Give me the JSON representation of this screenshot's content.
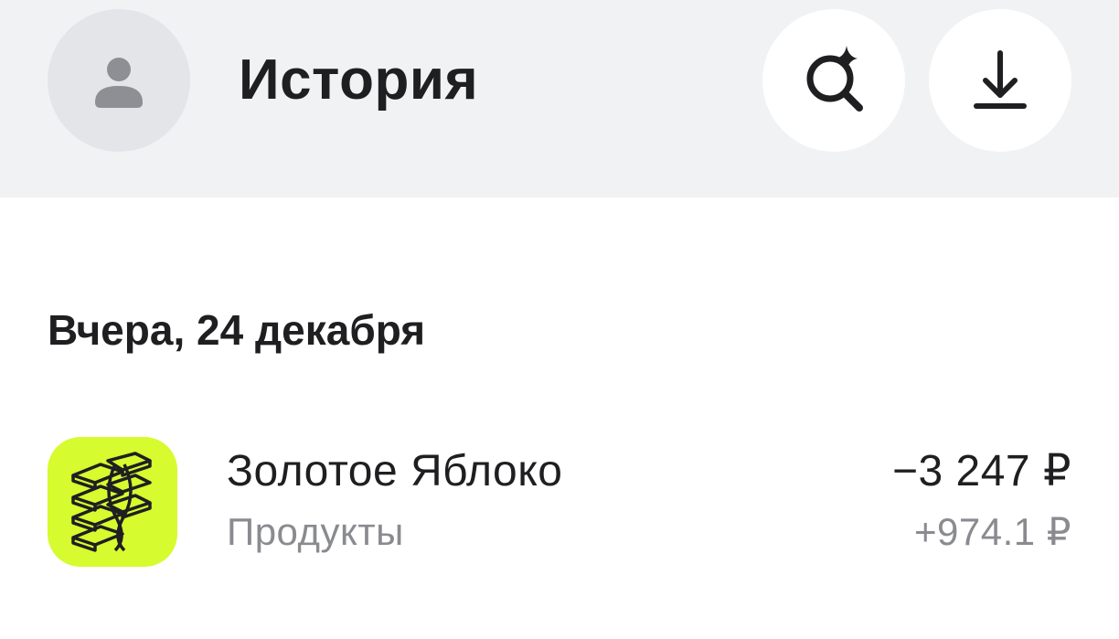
{
  "header": {
    "avatar_icon": "user-silhouette-icon",
    "title": "История",
    "search_icon": "ai-search-icon",
    "download_icon": "download-icon"
  },
  "sections": [
    {
      "date_label": "Вчера, 24 декабря",
      "transactions": [
        {
          "logo_icon": "zolotoe-yabloko-logo",
          "merchant": "Золотое Яблоко",
          "category": "Продукты",
          "amount": "−3 247 ₽",
          "cashback": "+974.1 ₽"
        }
      ]
    }
  ],
  "colors": {
    "header_bg": "#f1f2f4",
    "avatar_bg": "#e4e5e9",
    "logo_bg": "#d6fb2f",
    "text_primary": "#1f1f22",
    "text_secondary": "#8a8b90"
  }
}
